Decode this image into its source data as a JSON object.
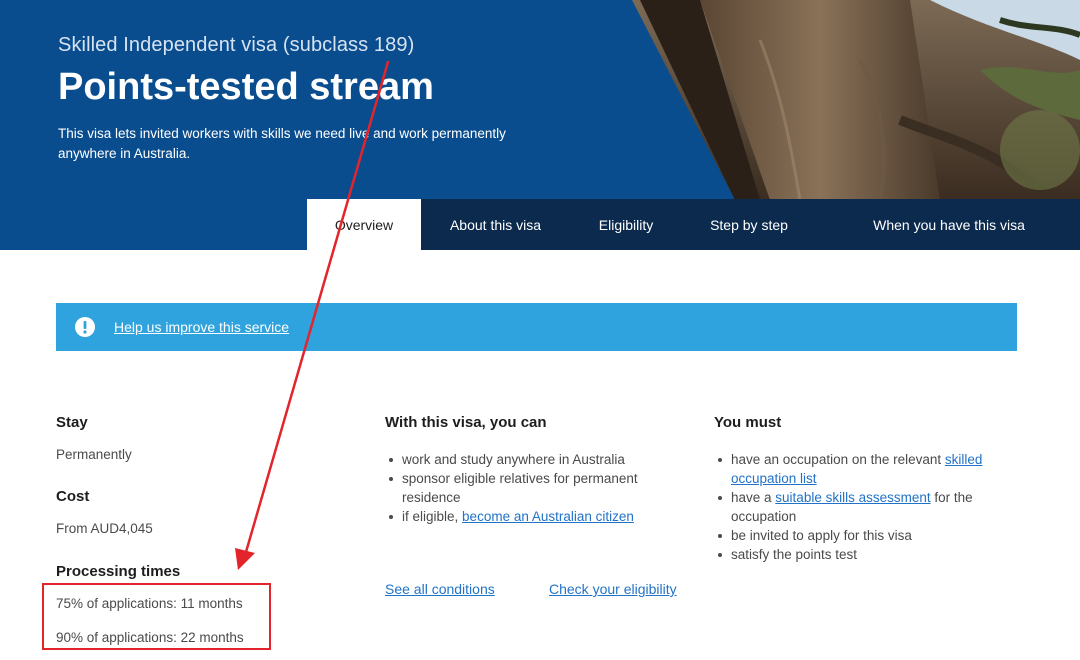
{
  "hero": {
    "subtitle": "Skilled Independent visa (subclass 189)",
    "title": "Points-tested stream",
    "description": "This visa lets invited workers with skills we need live and work permanently anywhere in Australia.",
    "background_color": "#0a4d8f"
  },
  "tabs": [
    {
      "label": "Overview",
      "active": true
    },
    {
      "label": "About this visa",
      "active": false
    },
    {
      "label": "Eligibility",
      "active": false
    },
    {
      "label": "Step by step",
      "active": false
    },
    {
      "label": "When you have this visa",
      "active": false
    }
  ],
  "banner": {
    "icon": "exclamation-circle-icon",
    "link_text": "Help us improve this service",
    "color": "#2ea3dd"
  },
  "summary": {
    "stay_heading": "Stay",
    "stay_value": "Permanently",
    "cost_heading": "Cost",
    "cost_value": "From AUD4,045",
    "processing_heading": "Processing times",
    "processing": [
      "75% of applications: 11 months",
      "90% of applications: 22 months"
    ]
  },
  "can": {
    "heading": "With this visa, you can",
    "items": [
      {
        "text": "work and study anywhere in Australia"
      },
      {
        "text": "sponsor eligible relatives for permanent residence"
      },
      {
        "prefix": "if eligible, ",
        "link": "become an Australian citizen"
      }
    ]
  },
  "must": {
    "heading": "You must",
    "items": [
      {
        "prefix": "have an occupation on the relevant ",
        "link": "skilled occupation list"
      },
      {
        "prefix": "have a ",
        "link": "suitable skills assessment",
        "suffix": " for the occupation"
      },
      {
        "text": "be invited to apply for this visa"
      },
      {
        "text": "satisfy the points test"
      }
    ]
  },
  "actions": {
    "see_conditions": "See all conditions",
    "check_eligibility": "Check your eligibility"
  },
  "annotation": {
    "color": "#e3242b"
  }
}
